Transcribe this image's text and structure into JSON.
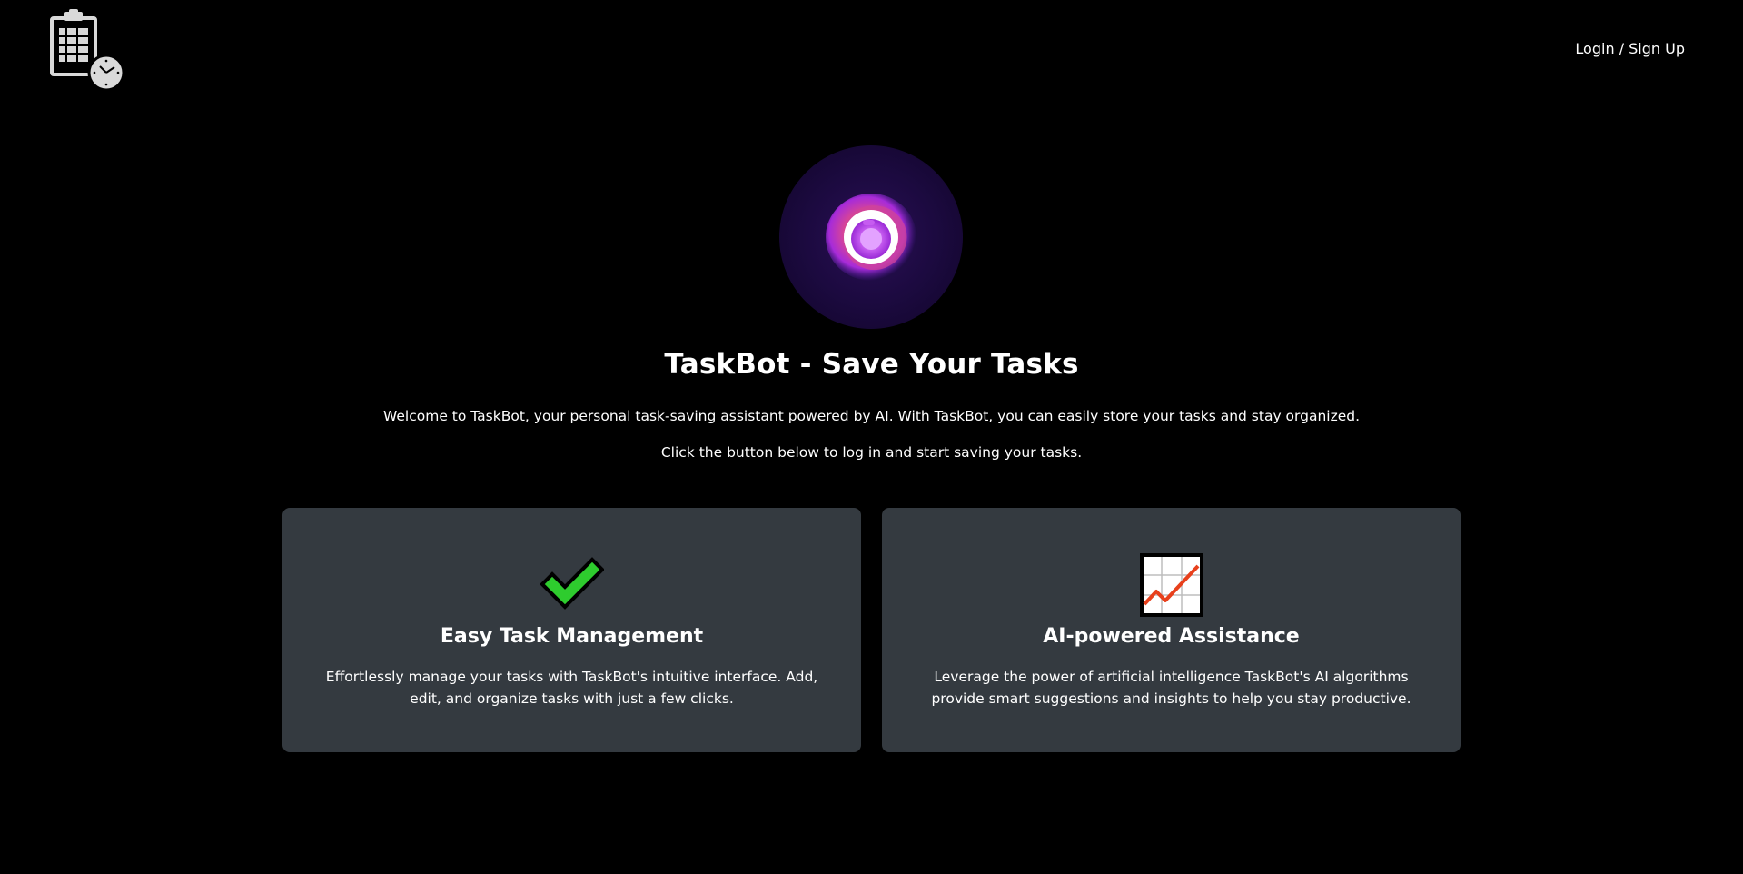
{
  "header": {
    "logo_icon": "clipboard-clock-icon",
    "login_label": "Login / Sign Up"
  },
  "hero": {
    "orb_icon": "ai-orb-icon",
    "title": "TaskBot - Save Your Tasks",
    "intro_line_1": "Welcome to TaskBot, your personal task-saving assistant powered by AI. With TaskBot, you can easily store your tasks and stay organized.",
    "intro_line_2": "Click the button below to log in and start saving your tasks."
  },
  "features": [
    {
      "icon": "check-mark-icon",
      "title": "Easy Task Management",
      "description": "Effortlessly manage your tasks with TaskBot's intuitive interface. Add, edit, and organize tasks with just a few clicks."
    },
    {
      "icon": "chart-increasing-icon",
      "title": "AI-powered Assistance",
      "description": "Leverage the power of artificial intelligence TaskBot's AI algorithms provide smart suggestions and insights to help you stay productive."
    }
  ],
  "colors": {
    "background": "#000000",
    "card_background": "#343a40",
    "text": "#ffffff",
    "check_green": "#2ecc2e",
    "chart_red": "#e8401c",
    "orb_purple": "#a72bd9"
  }
}
